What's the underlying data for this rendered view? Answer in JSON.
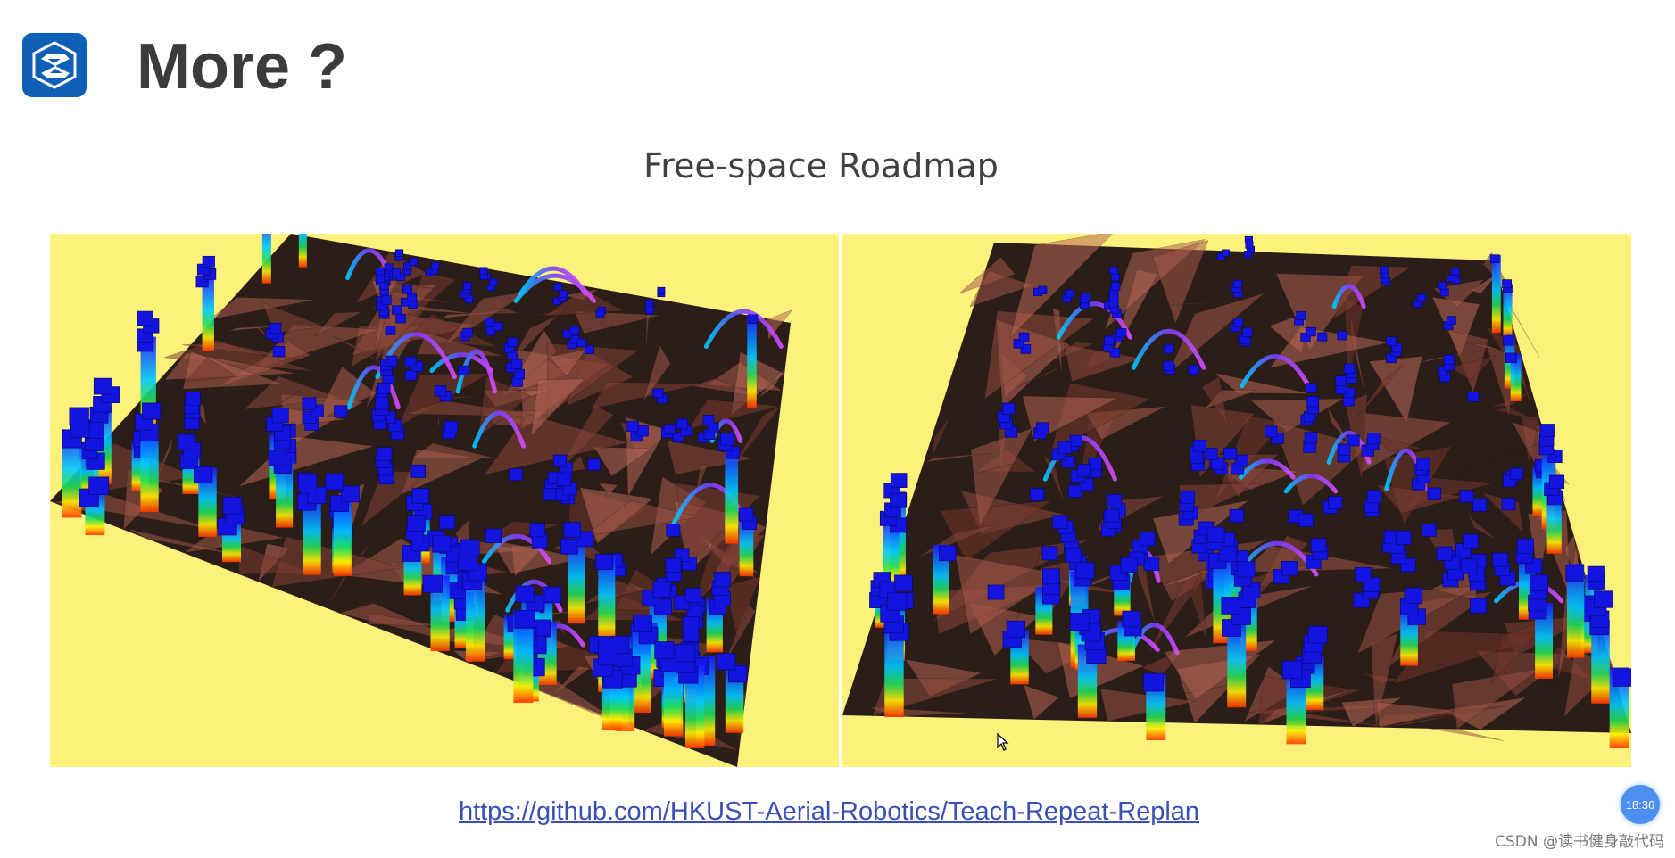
{
  "slide": {
    "title": "More ?",
    "subtitle": "Free-space Roadmap",
    "link": "https://github.com/HKUST-Aerial-Robotics/Teach-Repeat-Replan"
  },
  "images": {
    "left": {
      "name": "roadmap-render-left"
    },
    "right": {
      "name": "roadmap-render-right"
    }
  },
  "overlay": {
    "clock_time": "18:36",
    "watermark": "CSDN @读书健身敲代码"
  },
  "colors": {
    "background": "#ffffff",
    "logo": "#0e5fb6",
    "panel_bg": "#fcf17a",
    "obstacle": "#6b4a3e",
    "obstacle_dark": "#2b1d18",
    "voxel": "#1414e0",
    "link": "#3a4fb5",
    "clock": "#4d8ff0"
  }
}
